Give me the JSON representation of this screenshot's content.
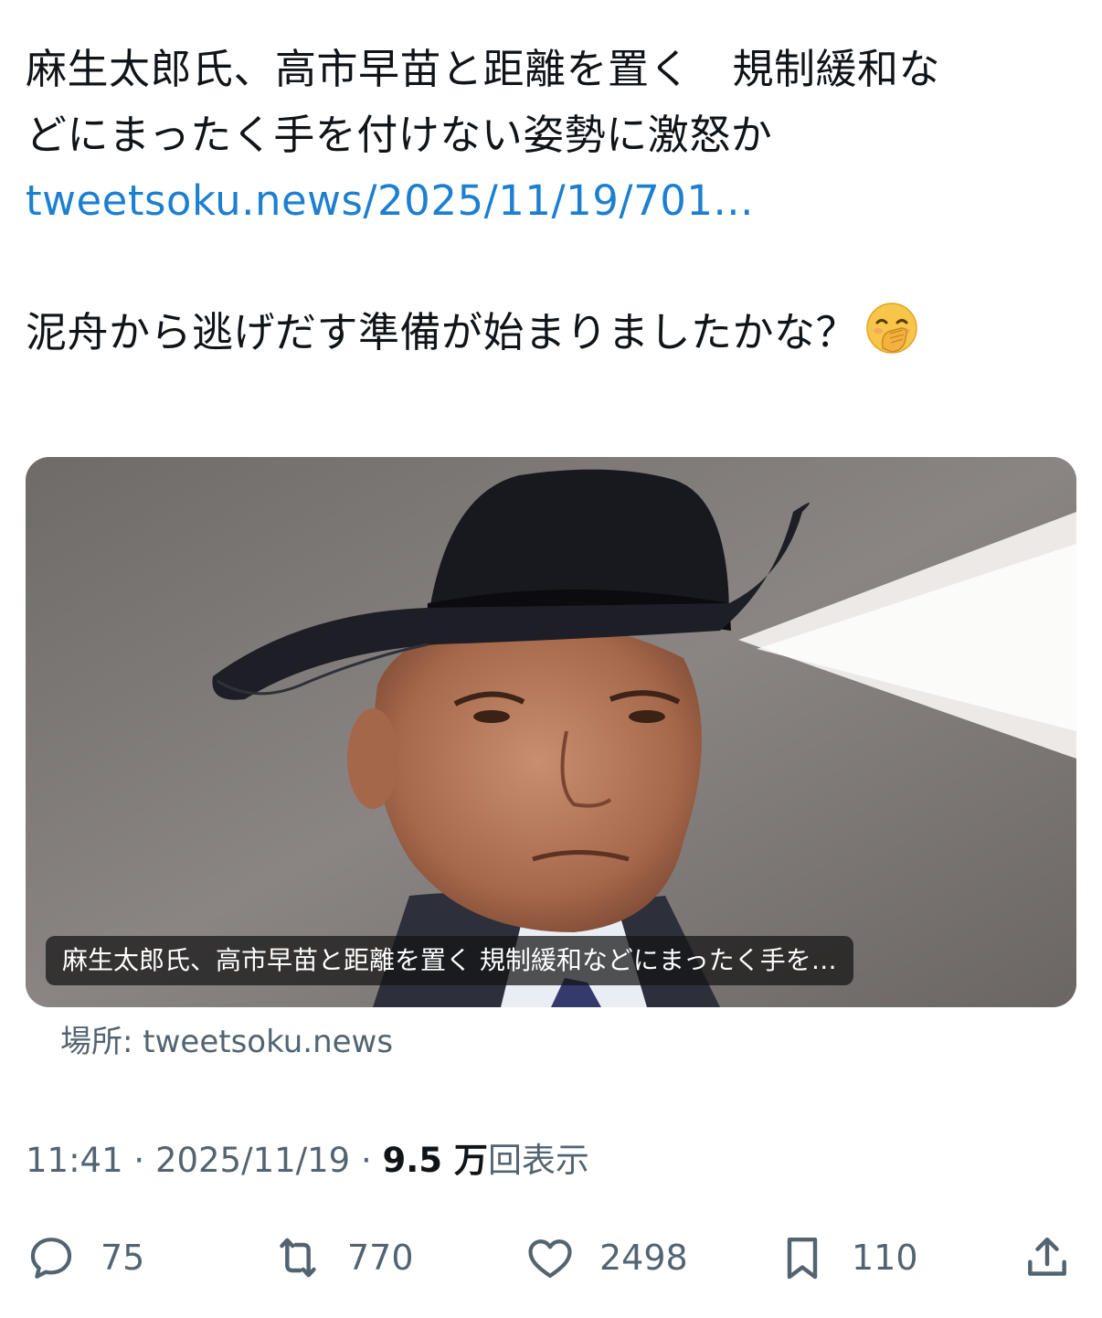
{
  "tweet": {
    "text_line1": "麻生太郎氏、高市早苗と距離を置く　規制緩和な",
    "text_line2": "どにまったく手を付けない姿勢に激怒か",
    "link": "tweetsoku.news/2025/11/19/701...",
    "comment": "泥舟から逃げだす準備が始まりましたかな？",
    "emoji": "face-with-hand-over-mouth-emoji"
  },
  "card": {
    "caption": "麻生太郎氏、高市早苗と距離を置く 規制緩和などにまったく手を…",
    "source": "場所: tweetsoku.news"
  },
  "meta": {
    "time": "11:41",
    "date": "2025/11/19",
    "views_count": "9.5 万",
    "views_label": "回表示",
    "separator": "·"
  },
  "actions": {
    "replies": "75",
    "retweets": "770",
    "likes": "2498",
    "bookmarks": "110"
  },
  "colors": {
    "link": "#1d7fd0",
    "secondary_text": "#536471",
    "primary_text": "#0f1419"
  }
}
